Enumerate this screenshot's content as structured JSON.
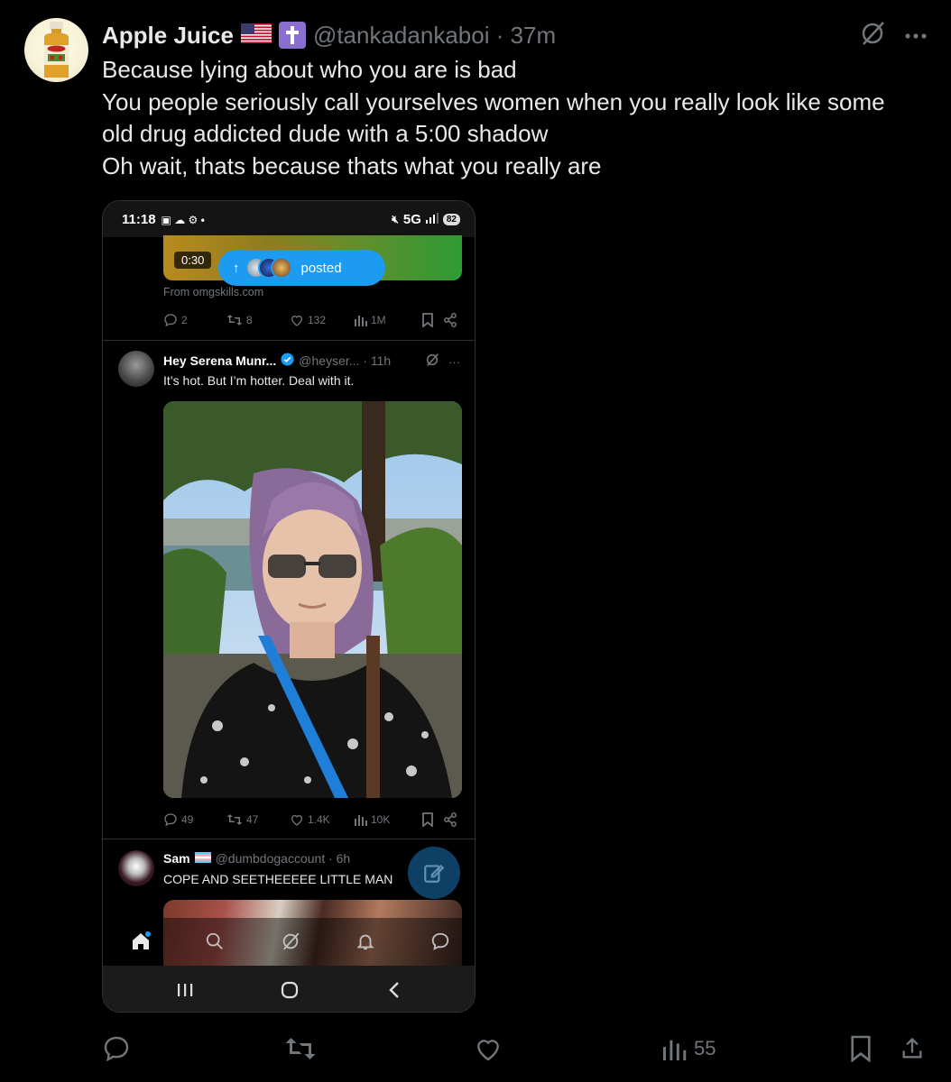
{
  "tweet": {
    "display_name": "Apple Juice",
    "handle_meta": "@tankadankaboi · 37m",
    "text_lines": [
      "Because lying about who you are is bad",
      "You people seriously call yourselves women when you really look like some",
      "old drug addicted dude with a 5:00 shadow",
      "Oh wait, thats because thats what you really are"
    ],
    "views": "55"
  },
  "phone": {
    "status_time": "11:18",
    "network": "5G",
    "battery": "82",
    "video_time": "0:30",
    "posted_label": "posted",
    "from_line": "From omgskills.com",
    "top_actions": {
      "replies": "2",
      "reposts": "8",
      "likes": "132",
      "views": "1M"
    },
    "serena": {
      "name": "Hey Serena Munr...",
      "handle_meta": "@heyser... · 11h",
      "text": "It’s hot. But I’m hotter. Deal with it.",
      "actions": {
        "replies": "49",
        "reposts": "47",
        "likes": "1.4K",
        "views": "10K"
      }
    },
    "sam": {
      "name": "Sam",
      "handle_meta": "@dumbdogaccount · 6h",
      "text": "COPE AND SEETHEEEEE LITTLE MAN"
    }
  },
  "colors": {
    "accent": "#1d9bf0",
    "muted": "#71767b",
    "background": "#000000"
  }
}
